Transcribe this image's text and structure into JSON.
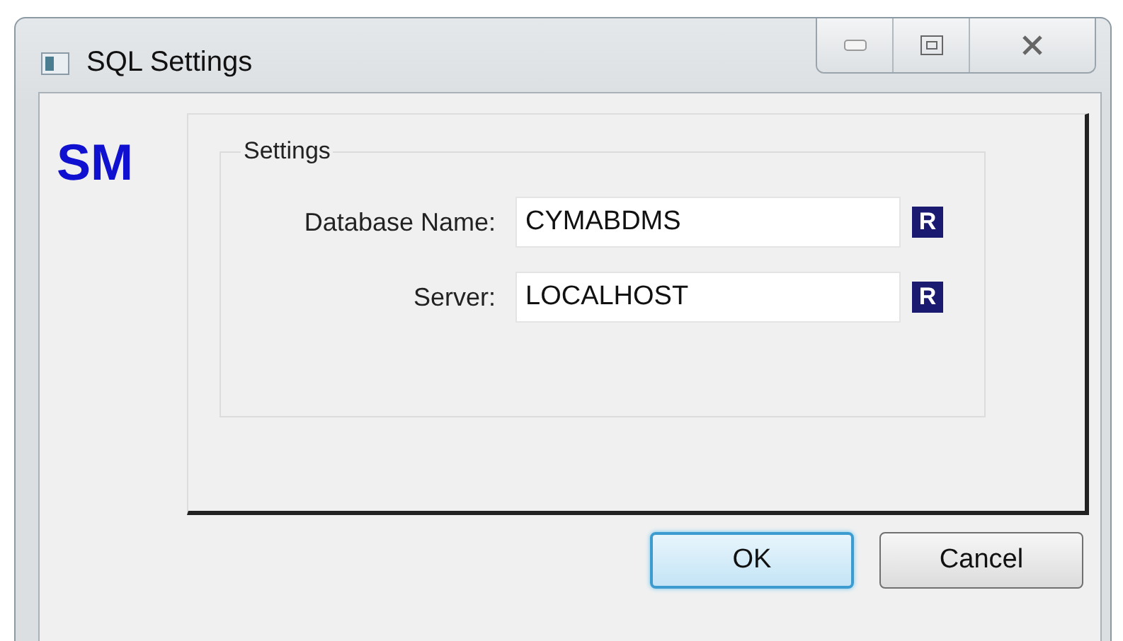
{
  "window": {
    "title": "SQL Settings"
  },
  "logo": "SM",
  "group": {
    "title": "Settings",
    "fields": [
      {
        "label": "Database Name:",
        "value": "CYMABDMS",
        "button_label": "R"
      },
      {
        "label": "Server:",
        "value": "LOCALHOST",
        "button_label": "R"
      }
    ]
  },
  "buttons": [
    {
      "label": "OK",
      "focused": true
    },
    {
      "label": "Cancel",
      "focused": false
    }
  ]
}
